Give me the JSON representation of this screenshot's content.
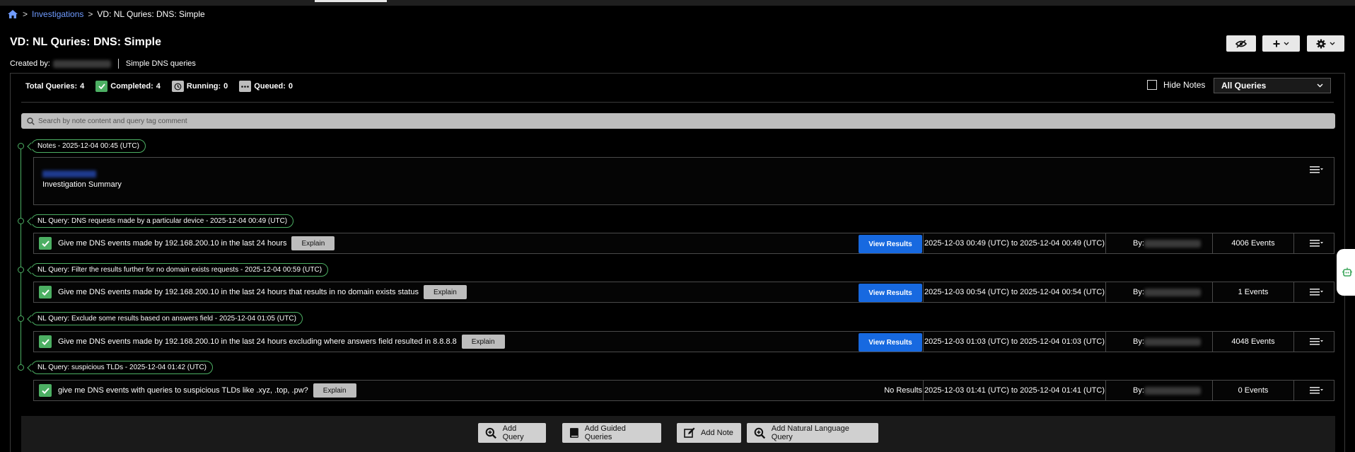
{
  "breadcrumb": {
    "link": "Investigations",
    "sep": ">",
    "current": "VD: NL Quries: DNS: Simple"
  },
  "page": {
    "title": "VD: NL Quries: DNS: Simple",
    "created_by_label": "Created by:",
    "description": "Simple DNS queries"
  },
  "header_buttons": {
    "plus": "+"
  },
  "stats": {
    "total_label": "Total Queries:",
    "total": "4",
    "completed_label": "Completed:",
    "completed": "4",
    "running_label": "Running:",
    "running": "0",
    "queued_label": "Queued:",
    "queued": "0"
  },
  "filters": {
    "hide_notes_label": "Hide Notes",
    "query_filter": "All Queries"
  },
  "search": {
    "placeholder": "Search by note content and query tag comment"
  },
  "timeline": [
    {
      "label": "Notes - 2025-12-04 00:45 (UTC)",
      "type": "note",
      "text": "Investigation Summary"
    },
    {
      "label": "NL Query: DNS requests made by a particular device - 2025-12-04 00:49 (UTC)",
      "type": "query",
      "text": "Give me DNS events made by 192.168.200.10 in the last 24 hours",
      "explain": "Explain",
      "action": "View Results",
      "range": "2025-12-03 00:49 (UTC) to 2025-12-04 00:49 (UTC)",
      "by": "By:",
      "events": "4006 Events"
    },
    {
      "label": "NL Query: Filter the results further for no domain exists requests - 2025-12-04 00:59 (UTC)",
      "type": "query",
      "text": "Give me DNS events made by 192.168.200.10 in the last 24 hours that results in no domain exists status",
      "explain": "Explain",
      "action": "View Results",
      "range": "2025-12-03 00:54 (UTC) to 2025-12-04 00:54 (UTC)",
      "by": "By:",
      "events": "1 Events"
    },
    {
      "label": "NL Query: Exclude some results based on answers field - 2025-12-04 01:05 (UTC)",
      "type": "query",
      "text": "Give me DNS events made by 192.168.200.10 in the last 24 hours excluding where answers field resulted in 8.8.8.8",
      "explain": "Explain",
      "action": "View Results",
      "range": "2025-12-03 01:03 (UTC) to 2025-12-04 01:03 (UTC)",
      "by": "By:",
      "events": "4048 Events"
    },
    {
      "label": "NL Query: suspicious TLDs - 2025-12-04 01:42 (UTC)",
      "type": "query",
      "text": "give me DNS events with queries to suspicious TLDs like .xyz, .top, .pw?",
      "explain": "Explain",
      "action": "No Results",
      "range": "2025-12-03 01:41 (UTC) to 2025-12-04 01:41 (UTC)",
      "by": "By:",
      "events": "0 Events"
    }
  ],
  "footer": {
    "add_query": "Add Query",
    "add_guided": "Add Guided Queries",
    "add_note": "Add Note",
    "add_nl": "Add Natural Language Query"
  },
  "colors": {
    "accent_green": "#4caf63",
    "primary_blue": "#1769e0",
    "link_blue": "#6f9bff"
  }
}
